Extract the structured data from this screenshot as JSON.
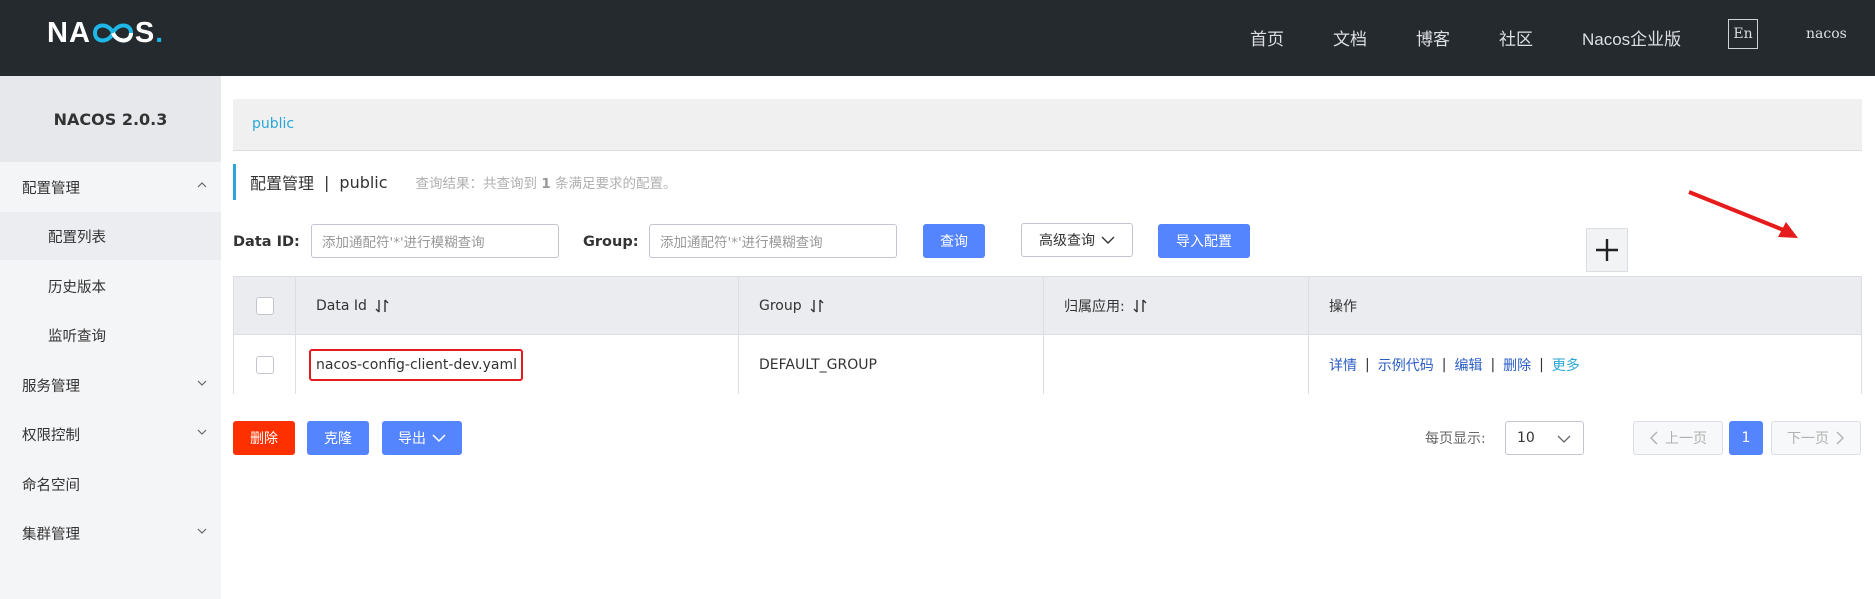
{
  "header": {
    "logo": {
      "prefix": "NA",
      "suffix": "S",
      "dot": "."
    },
    "nav": [
      "首页",
      "文档",
      "博客",
      "社区",
      "Nacos企业版"
    ],
    "lang": "En",
    "user": "nacos"
  },
  "sidebar": {
    "version": "NACOS 2.0.3",
    "items": [
      {
        "label": "配置管理",
        "expanded": true
      },
      {
        "label": "配置列表",
        "active": true
      },
      {
        "label": "历史版本"
      },
      {
        "label": "监听查询"
      },
      {
        "label": "服务管理",
        "expanded": false
      },
      {
        "label": "权限控制",
        "expanded": false
      },
      {
        "label": "命名空间"
      },
      {
        "label": "集群管理",
        "expanded": false
      }
    ]
  },
  "breadcrumb": "public",
  "title": {
    "main": "配置管理",
    "sep": "|",
    "namespace": "public",
    "note_prefix": "查询结果：共查询到",
    "note_count": "1",
    "note_suffix": "条满足要求的配置。"
  },
  "query": {
    "dataid_label": "Data ID:",
    "dataid_placeholder": "添加通配符'*'进行模糊查询",
    "group_label": "Group:",
    "group_placeholder": "添加通配符'*'进行模糊查询",
    "search": "查询",
    "advanced": "高级查询",
    "import": "导入配置"
  },
  "table": {
    "headers": [
      "Data Id",
      "Group",
      "归属应用:",
      "操作"
    ],
    "rows": [
      {
        "data_id": "nacos-config-client-dev.yaml",
        "group": "DEFAULT_GROUP",
        "app": "",
        "ops": [
          "详情",
          "示例代码",
          "编辑",
          "删除",
          "更多"
        ]
      }
    ]
  },
  "actions": {
    "delete": "删除",
    "clone": "克隆",
    "export": "导出"
  },
  "pagination": {
    "page_size_label": "每页显示:",
    "page_size": "10",
    "prev": "上一页",
    "current": "1",
    "next": "下一页"
  },
  "colors": {
    "topbar": "#252a2f",
    "primary": "#5584ff",
    "danger": "#ff3000",
    "accent": "#2aa7d6",
    "highlight": "#e61b1b"
  }
}
